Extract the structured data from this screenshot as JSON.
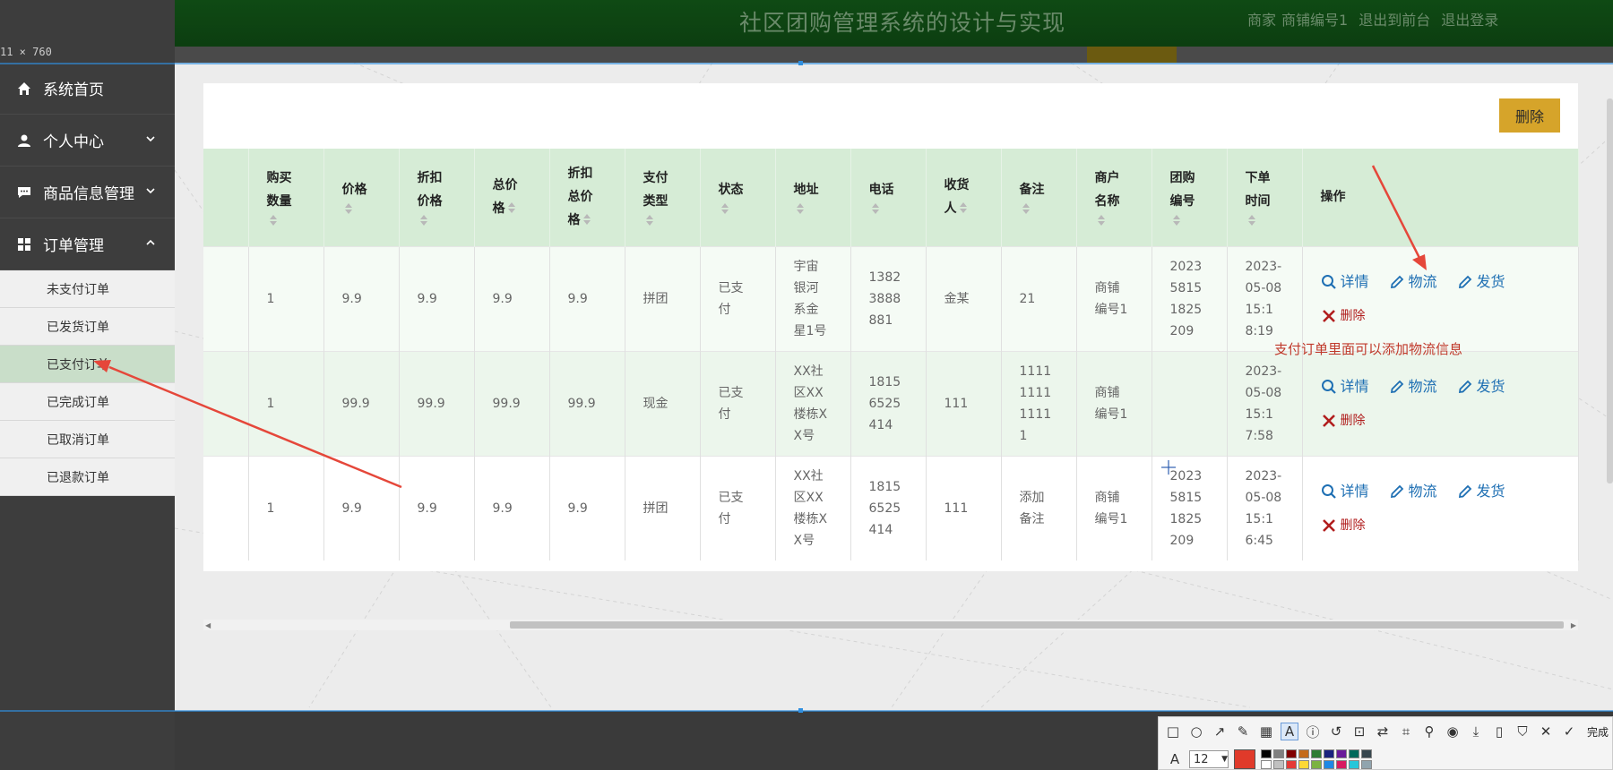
{
  "app": {
    "title": "社区团购管理系统的设计与实现",
    "role": "商家",
    "user": "商铺编号1",
    "to_front": "退出到前台",
    "logout": "退出登录",
    "size_label": "11 × 760"
  },
  "sidebar": {
    "items": [
      {
        "label": "系统首页",
        "icon": "home-icon"
      },
      {
        "label": "个人中心",
        "icon": "user-icon"
      },
      {
        "label": "商品信息管理",
        "icon": "chat-icon"
      },
      {
        "label": "订单管理",
        "icon": "grid-icon"
      }
    ],
    "sub_items": [
      "未支付订单",
      "已发货订单",
      "已支付订单",
      "已完成订单",
      "已取消订单",
      "已退款订单"
    ],
    "active_sub": "已支付订单"
  },
  "toolbar": {
    "delete_label": "删除"
  },
  "table": {
    "headers": [
      "购买数量",
      "价格",
      "折扣价格",
      "总价格",
      "折扣总价格",
      "支付类型",
      "状态",
      "地址",
      "电话",
      "收货人",
      "备注",
      "商户名称",
      "团购编号",
      "下单时间",
      "操作"
    ],
    "header_lines": [
      [
        "购买",
        "数量"
      ],
      [
        "价格"
      ],
      [
        "折扣",
        "价格"
      ],
      [
        "总价",
        "格"
      ],
      [
        "折扣",
        "总价",
        "格"
      ],
      [
        "支付",
        "类型"
      ],
      [
        "状态"
      ],
      [
        "地址"
      ],
      [
        "电话"
      ],
      [
        "收货",
        "人"
      ],
      [
        "备注"
      ],
      [
        "商户",
        "名称"
      ],
      [
        "团购",
        "编号"
      ],
      [
        "下单",
        "时间"
      ],
      [
        "操作"
      ]
    ],
    "rows": [
      {
        "qty": "1",
        "price": "9.9",
        "disc_price": "9.9",
        "total": "9.9",
        "disc_total": "9.9",
        "pay_type": "拼团",
        "status": "已支付",
        "address": "宇宙银河系金星1号",
        "phone": "13823888881",
        "receiver": "金某",
        "note": "21",
        "merchant": "商铺编号1",
        "group_no": "20235815 1825209",
        "time": "2023-05-0815:18:19"
      },
      {
        "qty": "1",
        "price": "99.9",
        "disc_price": "99.9",
        "total": "99.9",
        "disc_total": "99.9",
        "pay_type": "现金",
        "status": "已支付",
        "address": "XX社区XX楼栋XX号",
        "phone": "18156525414",
        "receiver": "111",
        "note": "1111111111111",
        "merchant": "商铺编号1",
        "group_no": "",
        "time": "2023-05-0815:17:58"
      },
      {
        "qty": "1",
        "price": "9.9",
        "disc_price": "9.9",
        "total": "9.9",
        "disc_total": "9.9",
        "pay_type": "拼团",
        "status": "已支付",
        "address": "XX社区XX楼栋XX号",
        "phone": "18156525414",
        "receiver": "111",
        "note": "添加备注",
        "merchant": "商铺编号1",
        "group_no": "20235815 1825209",
        "time": "2023-05-0815:16:45"
      }
    ],
    "row_cells": [
      {
        "qty": [
          "1"
        ],
        "price": [
          "9.9"
        ],
        "disc_price": [
          "9.9"
        ],
        "total": [
          "9.9"
        ],
        "disc_total": [
          "9.9"
        ],
        "pay_type": [
          "拼团"
        ],
        "status": [
          "已支",
          "付"
        ],
        "address": [
          "宇宙",
          "银河",
          "系金",
          "星1号"
        ],
        "phone": [
          "1382",
          "3888",
          "881"
        ],
        "receiver": [
          "金某"
        ],
        "note": [
          "21"
        ],
        "merchant": [
          "商铺",
          "编号1"
        ],
        "group_no": [
          "2023",
          "5815",
          "1825",
          "209"
        ],
        "time": [
          "2023-",
          "05-08",
          "15:1",
          "8:19"
        ]
      },
      {
        "qty": [
          "1"
        ],
        "price": [
          "99.9"
        ],
        "disc_price": [
          "99.9"
        ],
        "total": [
          "99.9"
        ],
        "disc_total": [
          "99.9"
        ],
        "pay_type": [
          "现金"
        ],
        "status": [
          "已支",
          "付"
        ],
        "address": [
          "XX社",
          "区XX",
          "楼栋X",
          "X号"
        ],
        "phone": [
          "1815",
          "6525",
          "414"
        ],
        "receiver": [
          "111"
        ],
        "note": [
          "1111",
          "1111",
          "1111",
          "1"
        ],
        "merchant": [
          "商铺",
          "编号1"
        ],
        "group_no": [],
        "time": [
          "2023-",
          "05-08",
          "15:1",
          "7:58"
        ]
      },
      {
        "qty": [
          "1"
        ],
        "price": [
          "9.9"
        ],
        "disc_price": [
          "9.9"
        ],
        "total": [
          "9.9"
        ],
        "disc_total": [
          "9.9"
        ],
        "pay_type": [
          "拼团"
        ],
        "status": [
          "已支",
          "付"
        ],
        "address": [
          "XX社",
          "区XX",
          "楼栋X",
          "X号"
        ],
        "phone": [
          "1815",
          "6525",
          "414"
        ],
        "receiver": [
          "111"
        ],
        "note": [
          "添加",
          "备注"
        ],
        "merchant": [
          "商铺",
          "编号1"
        ],
        "group_no": [
          "2023",
          "5815",
          "1825",
          "209"
        ],
        "time": [
          "2023-",
          "05-08",
          "15:1",
          "6:45"
        ]
      }
    ],
    "actions": {
      "detail": "详情",
      "logistics": "物流",
      "ship": "发货",
      "delete": "删除"
    }
  },
  "annotation": {
    "text": "支付订单里面可以添加物流信息"
  },
  "shot_toolbar": {
    "done": "完成",
    "font_size": "12",
    "colors": {
      "current": "#e03a2a",
      "accent": "#1e6fb3",
      "danger": "#b11d1d",
      "button": "#d6a42a",
      "header_green": "#d6ecd6"
    }
  }
}
